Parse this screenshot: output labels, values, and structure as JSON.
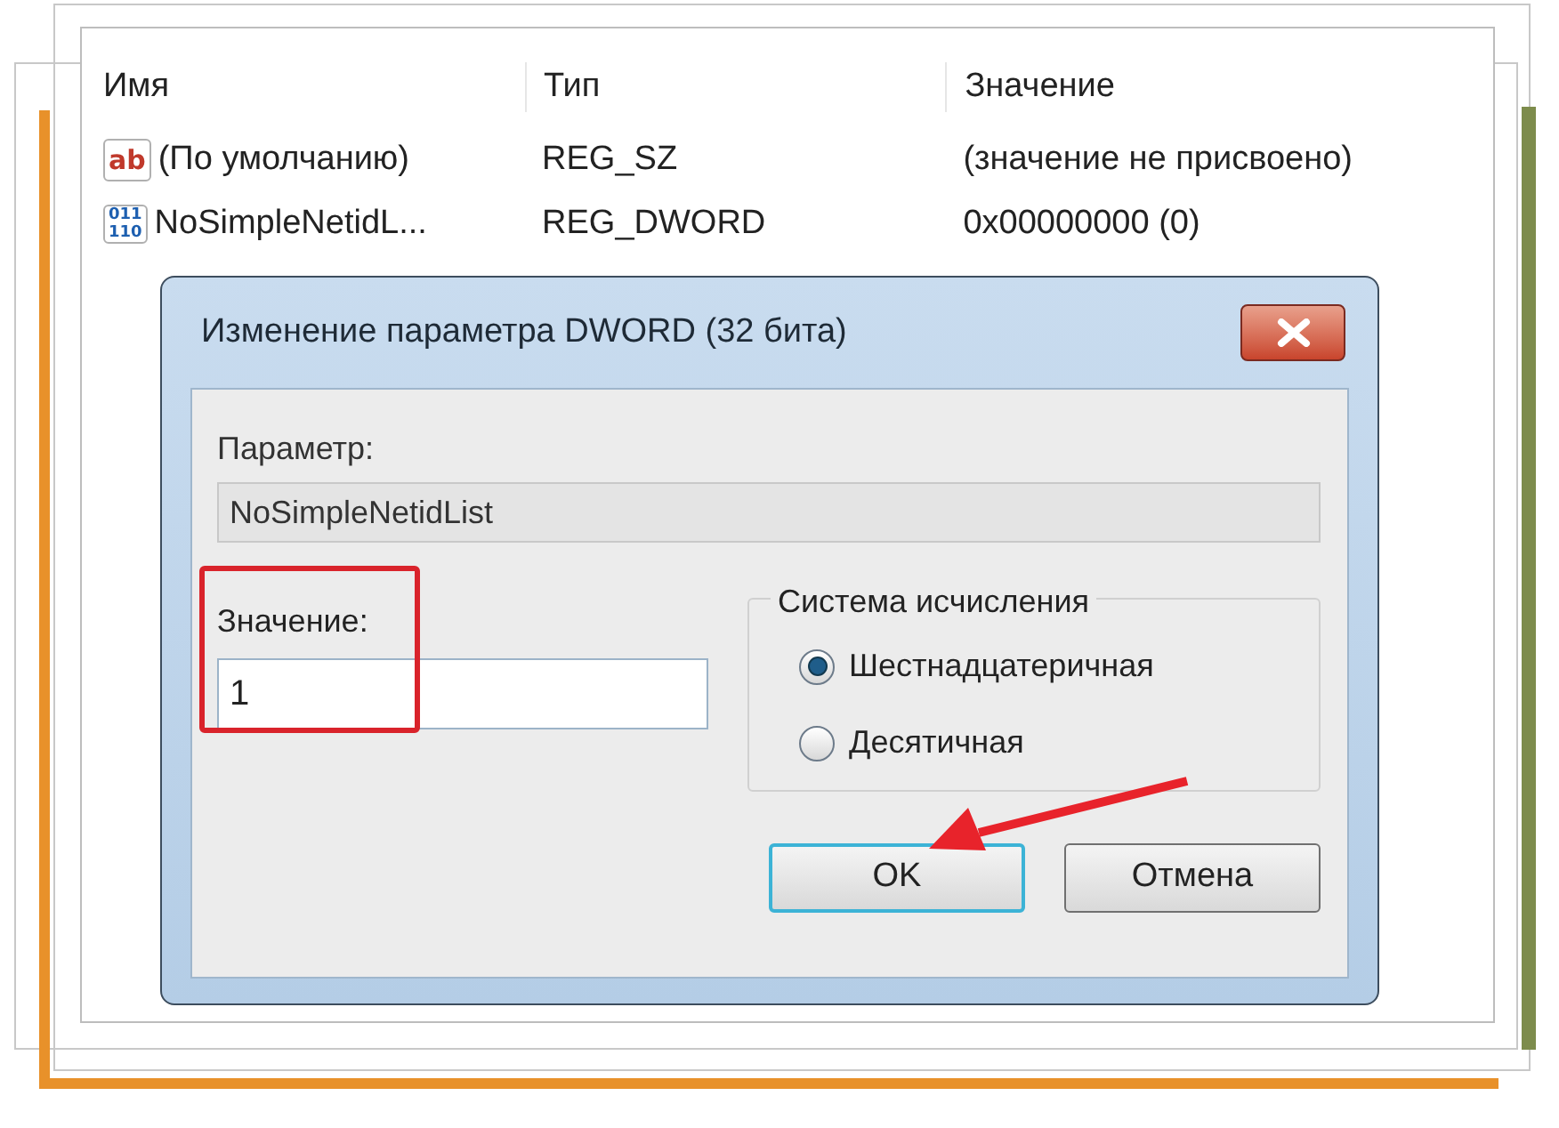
{
  "columns": [
    {
      "label": "Имя"
    },
    {
      "label": "Тип"
    },
    {
      "label": "Значение"
    }
  ],
  "rows": [
    {
      "kind": "string",
      "icon_lines": [
        "ab"
      ],
      "name": "(По умолчанию)",
      "type": "REG_SZ",
      "value": "(значение не присвоено)"
    },
    {
      "kind": "dword",
      "icon_lines": [
        "011",
        "110"
      ],
      "name": "NoSimpleNetidL...",
      "type": "REG_DWORD",
      "value": "0x00000000 (0)"
    }
  ],
  "dialog": {
    "title": "Изменение параметра DWORD (32 бита)",
    "parameter_label": "Параметр:",
    "parameter_value": "NoSimpleNetidList",
    "value_label": "Значение:",
    "value": "1",
    "base_group": {
      "title": "Система исчисления",
      "options": [
        {
          "label": "Шестнадцатеричная",
          "selected": true
        },
        {
          "label": "Десятичная",
          "selected": false
        }
      ]
    },
    "buttons": [
      {
        "label": "OK",
        "default": true
      },
      {
        "label": "Отмена",
        "default": false
      }
    ]
  }
}
